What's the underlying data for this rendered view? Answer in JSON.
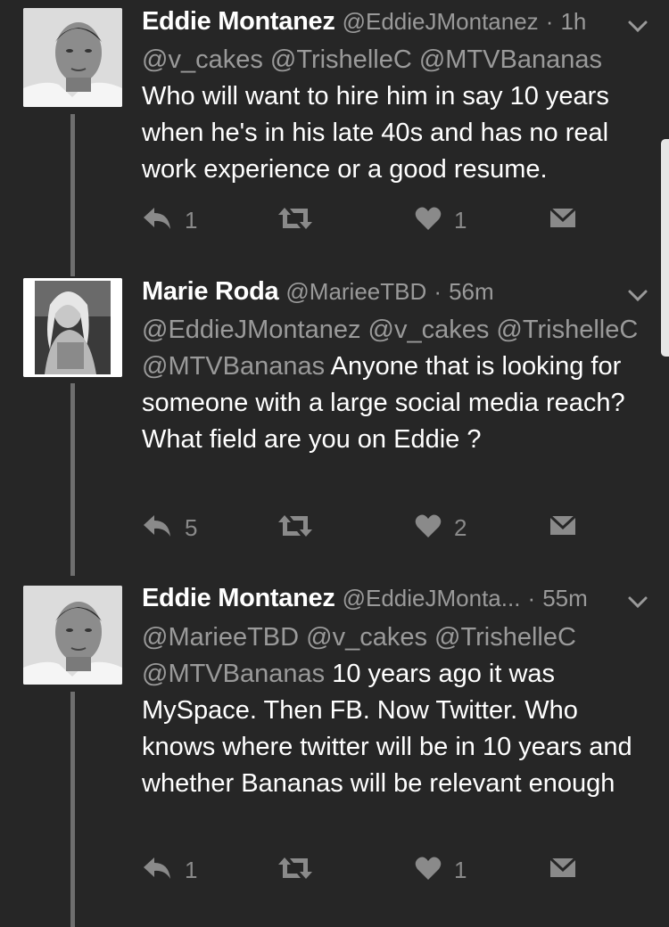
{
  "tweets": [
    {
      "name": "Eddie Montanez",
      "handle": "@EddieJMontanez",
      "time": "1h",
      "mentions": "@v_cakes @TrishelleC @MTVBananas",
      "text": "Who will want to hire him in say 10 years when he's in his late 40s and has no real work experience or a good resume.",
      "replies": "1",
      "likes": "1"
    },
    {
      "name": "Marie Roda",
      "handle": "@MarieeTBD",
      "time": "56m",
      "mentions": "@EddieJMontanez @v_cakes @TrishelleC @MTVBananas",
      "text": "Anyone that is looking for someone with a large social media reach? What field are you on Eddie ?",
      "replies": "5",
      "likes": "2"
    },
    {
      "name": "Eddie Montanez",
      "handle": "@EddieJMonta...",
      "time": "55m",
      "mentions": "@MarieeTBD @v_cakes @TrishelleC @MTVBananas",
      "text": "10 years ago it was MySpace. Then FB. Now Twitter. Who knows where twitter will be in 10 years and whether Bananas will be relevant enough",
      "replies": "1",
      "likes": "1"
    }
  ],
  "separator": "·",
  "icons": {
    "reply": "reply-arrow-icon",
    "retweet": "retweet-icon",
    "like": "heart-icon",
    "dm": "envelope-icon",
    "menu": "chevron-down-icon"
  },
  "colors": {
    "background": "#262626",
    "text": "#ffffff",
    "secondary": "#9a9a9a",
    "icon": "#8a8a8a",
    "thread_line": "#6e6e6e"
  }
}
